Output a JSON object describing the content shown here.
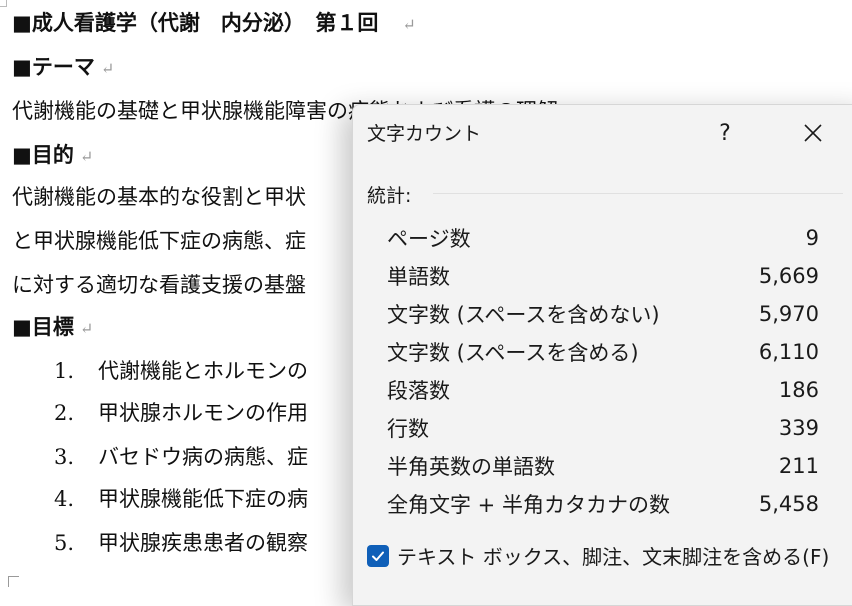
{
  "document": {
    "title_line": "■成人看護学（代謝　内分泌）　第１回",
    "theme_heading": "■テーマ",
    "theme_text": "代謝機能の基礎と甲状腺機能障害の病態および看護の理解",
    "purpose_heading": "■目的",
    "purpose_lines": [
      "代謝機能の基本的な役割と甲状",
      "と甲状腺機能低下症の病態、症",
      "に対する適切な看護支援の基盤"
    ],
    "goals_heading": "■目標",
    "goals": [
      {
        "num": "1.",
        "text": "代謝機能とホルモンの"
      },
      {
        "num": "2.",
        "text": "甲状腺ホルモンの作用"
      },
      {
        "num": "3.",
        "text": "バセドウ病の病態、症"
      },
      {
        "num": "4.",
        "text": "甲状腺機能低下症の病"
      },
      {
        "num": "5.",
        "text": "甲状腺疾患患者の観察"
      }
    ],
    "paragraph_mark": "↵"
  },
  "dialog": {
    "title": "文字カウント",
    "help_label": "?",
    "section_label": "統計:",
    "stats": [
      {
        "label": "ページ数",
        "value": "9"
      },
      {
        "label": "単語数",
        "value": "5,669"
      },
      {
        "label": "文字数 (スペースを含めない)",
        "value": "5,970"
      },
      {
        "label": "文字数 (スペースを含める)",
        "value": "6,110"
      },
      {
        "label": "段落数",
        "value": "186"
      },
      {
        "label": "行数",
        "value": "339"
      },
      {
        "label": "半角英数の単語数",
        "value": "211"
      },
      {
        "label": "全角文字 + 半角カタカナの数",
        "value": "5,458"
      }
    ],
    "checkbox_label": "テキスト ボックス、脚注、文末脚注を含める(F)",
    "checkbox_checked": true
  },
  "colors": {
    "accent": "#0f5fb8",
    "dialog_bg": "#f3f3f3",
    "mark": "#9a9a9a"
  }
}
